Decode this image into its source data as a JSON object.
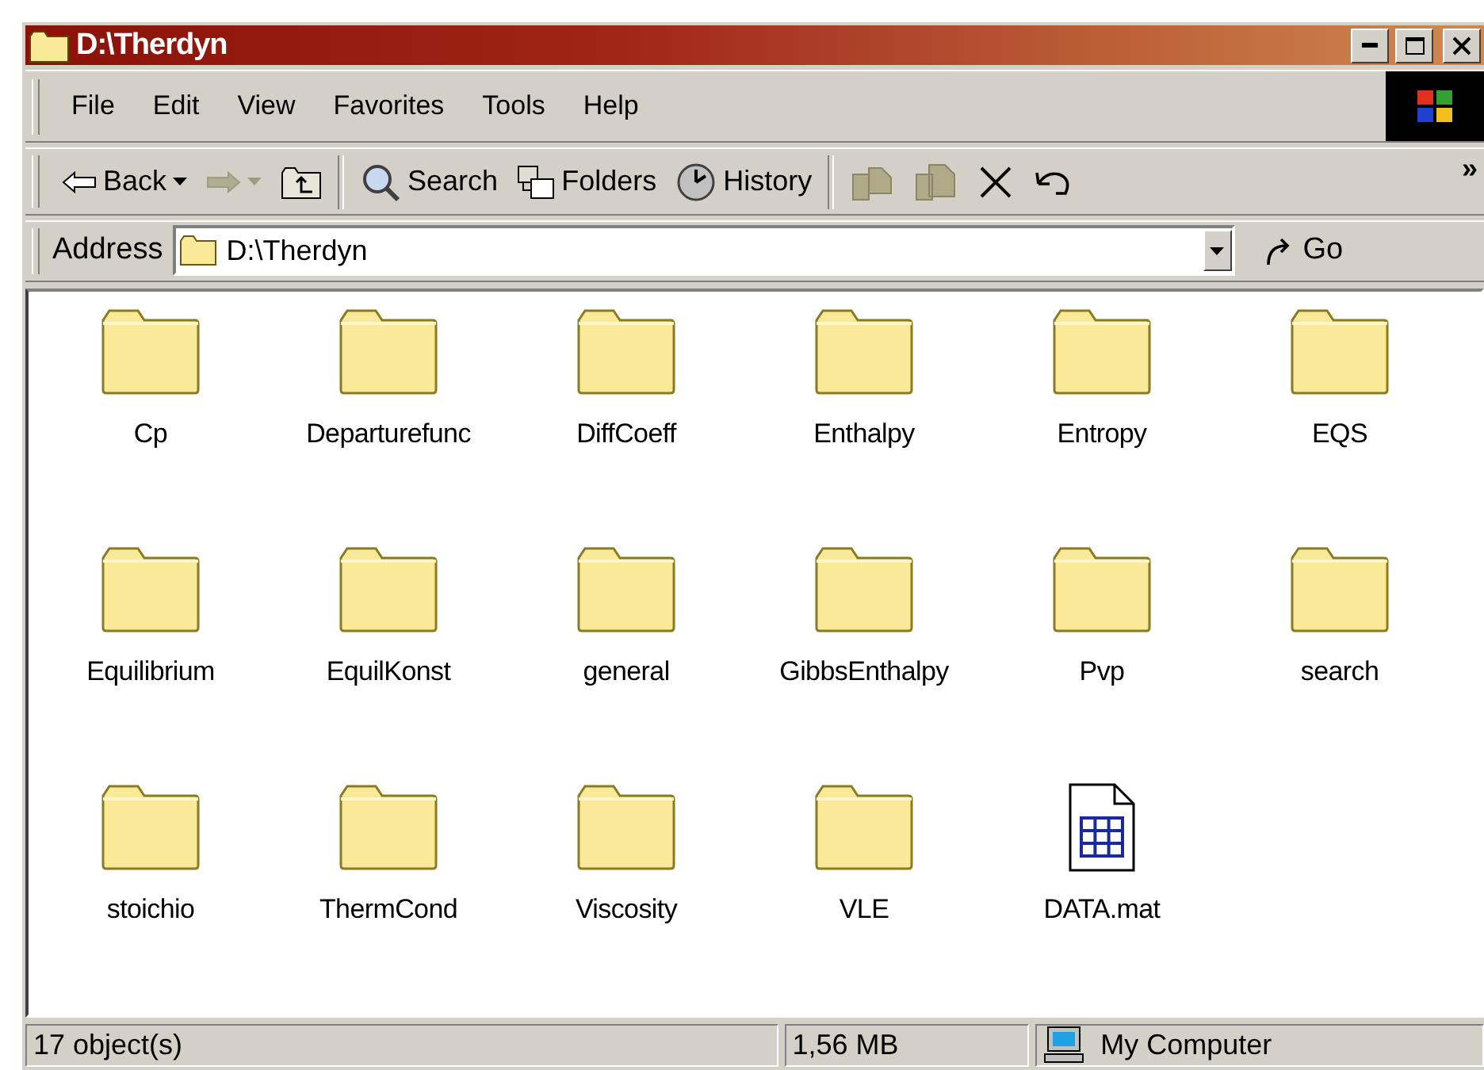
{
  "window": {
    "title": "D:\\Therdyn"
  },
  "menu": [
    {
      "label": "File"
    },
    {
      "label": "Edit"
    },
    {
      "label": "View"
    },
    {
      "label": "Favorites"
    },
    {
      "label": "Tools"
    },
    {
      "label": "Help"
    }
  ],
  "toolbar": [
    {
      "kind": "back",
      "label": "Back",
      "dropdown": true,
      "disabled": false
    },
    {
      "kind": "forward",
      "dropdown": true,
      "disabled": true
    },
    {
      "kind": "up",
      "dropdown": false,
      "disabled": false
    },
    {
      "kind": "separator"
    },
    {
      "kind": "search",
      "label": "Search",
      "dropdown": false,
      "disabled": false
    },
    {
      "kind": "folders",
      "label": "Folders",
      "dropdown": false,
      "disabled": false
    },
    {
      "kind": "history",
      "label": "History",
      "dropdown": false,
      "disabled": false
    },
    {
      "kind": "separator"
    },
    {
      "kind": "move",
      "dropdown": false,
      "disabled": true
    },
    {
      "kind": "copy",
      "dropdown": false,
      "disabled": true
    },
    {
      "kind": "delete",
      "dropdown": false,
      "disabled": false
    },
    {
      "kind": "undo",
      "dropdown": false,
      "disabled": false
    }
  ],
  "toolbar_overflow": "»",
  "address": {
    "label": "Address",
    "value": "D:\\Therdyn",
    "go": "Go"
  },
  "items": [
    {
      "name": "Cp",
      "kind": "folder"
    },
    {
      "name": "Departurefunc",
      "kind": "folder"
    },
    {
      "name": "DiffCoeff",
      "kind": "folder"
    },
    {
      "name": "Enthalpy",
      "kind": "folder"
    },
    {
      "name": "Entropy",
      "kind": "folder"
    },
    {
      "name": "EQS",
      "kind": "folder"
    },
    {
      "name": "Equilibrium",
      "kind": "folder"
    },
    {
      "name": "EquilKonst",
      "kind": "folder"
    },
    {
      "name": "general",
      "kind": "folder"
    },
    {
      "name": "GibbsEnthalpy",
      "kind": "folder"
    },
    {
      "name": "Pvp",
      "kind": "folder"
    },
    {
      "name": "search",
      "kind": "folder"
    },
    {
      "name": "stoichio",
      "kind": "folder"
    },
    {
      "name": "ThermCond",
      "kind": "folder"
    },
    {
      "name": "Viscosity",
      "kind": "folder"
    },
    {
      "name": "VLE",
      "kind": "folder"
    },
    {
      "name": "DATA.mat",
      "kind": "file"
    }
  ],
  "status_bar": [
    {
      "text": "17 object(s)",
      "kind": "plain"
    },
    {
      "text": "1,56 MB",
      "kind": "plain"
    },
    {
      "text": "My Computer",
      "kind": "computer"
    }
  ]
}
